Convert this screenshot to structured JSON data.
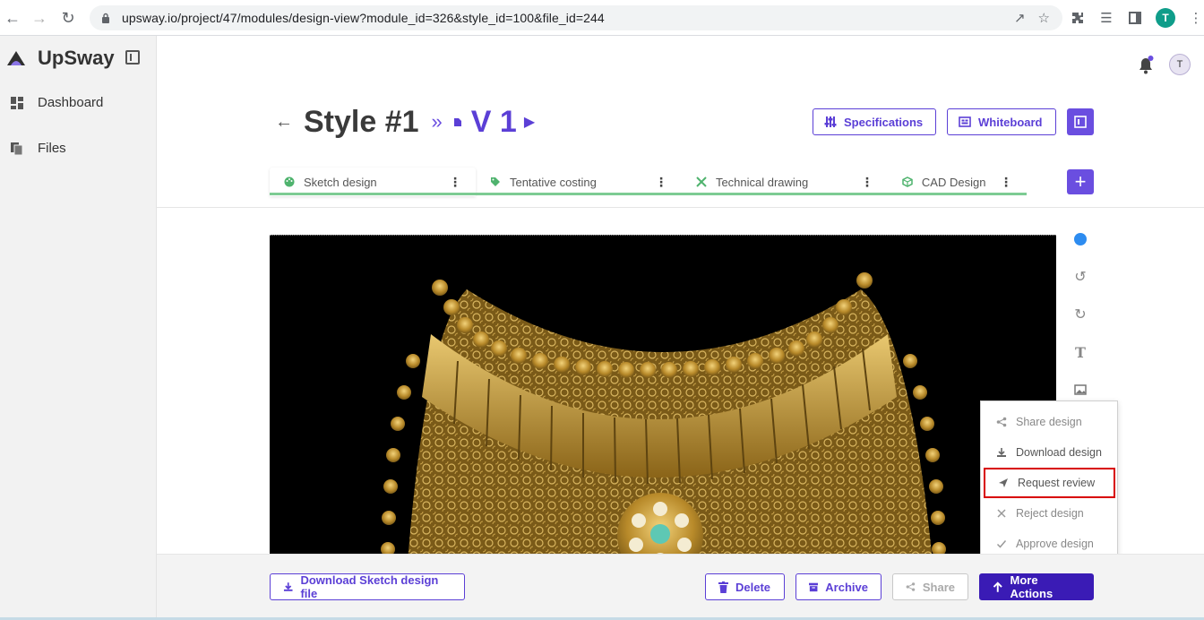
{
  "browser": {
    "url": "upsway.io/project/47/modules/design-view?module_id=326&style_id=100&file_id=244",
    "profile_initial": "T"
  },
  "sidebar": {
    "app_name": "UpSway",
    "items": [
      {
        "label": "Dashboard",
        "icon": "dashboard-icon"
      },
      {
        "label": "Files",
        "icon": "files-icon"
      }
    ]
  },
  "header": {
    "user_initial": "T",
    "style_title": "Style #1",
    "version_title": "V 1",
    "specifications_label": "Specifications",
    "whiteboard_label": "Whiteboard"
  },
  "tabs": [
    {
      "label": "Sketch design",
      "icon": "palette-icon",
      "active": true
    },
    {
      "label": "Tentative costing",
      "icon": "tag-icon",
      "active": false
    },
    {
      "label": "Technical drawing",
      "icon": "drafting-icon",
      "active": false
    },
    {
      "label": "CAD Design",
      "icon": "cube-icon",
      "active": false
    }
  ],
  "menu": {
    "items": [
      {
        "label": "Share design",
        "icon": "share-icon"
      },
      {
        "label": "Download design",
        "icon": "download-icon"
      },
      {
        "label": "Request review",
        "icon": "send-icon"
      },
      {
        "label": "Reject design",
        "icon": "x-icon"
      },
      {
        "label": "Approve design",
        "icon": "check-icon"
      }
    ]
  },
  "bottombar": {
    "download_label": "Download Sketch design file",
    "delete_label": "Delete",
    "archive_label": "Archive",
    "share_label": "Share",
    "more_actions_label": "More Actions"
  },
  "colors": {
    "accent": "#5b3fd6",
    "primary_dark": "#3a1bb5",
    "tab_underline": "#7dcb93",
    "highlight_border": "#d80000"
  }
}
